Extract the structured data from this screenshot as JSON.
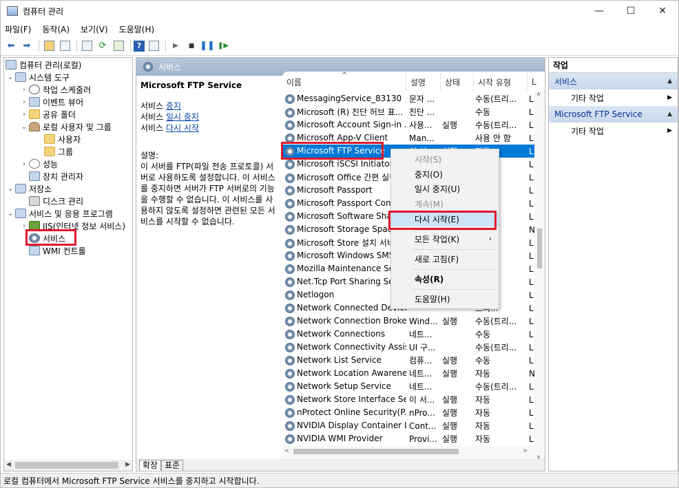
{
  "window": {
    "title": "컴퓨터 관리",
    "min": "—",
    "max": "☐",
    "close": "✕"
  },
  "menu": [
    "파일(F)",
    "동작(A)",
    "보기(V)",
    "도움말(H)"
  ],
  "tree": {
    "root": "컴퓨터 관리(로컬)",
    "system_tools": "시스템 도구",
    "task_scheduler": "작업 스케줄러",
    "event_viewer": "이벤트 뷰어",
    "shared_folders": "공유 폴더",
    "local_users": "로컬 사용자 및 그룹",
    "users": "사용자",
    "groups": "그룹",
    "performance": "성능",
    "device_manager": "장치 관리자",
    "storage": "저장소",
    "disk_mgmt": "디스크 관리",
    "services_apps": "서비스 및 응용 프로그램",
    "iis": "IIS(인터넷 정보 서비스)",
    "services": "서비스",
    "wmi": "WMI 컨트롤"
  },
  "center": {
    "header": "서비스",
    "service_name": "Microsoft FTP Service",
    "prefix": "서비스",
    "link_stop": "중지",
    "link_pause": "일시 중지",
    "link_restart": "다시 시작",
    "desc_label": "설명:",
    "desc_text": "이 서버를 FTP(파일 전송 프로토콜) 서버로 사용하도록 설정합니다. 이 서비스를 중지하면 서버가 FTP 서버로의 기능을 수행할 수 없습니다. 이 서비스를 사용하지 않도록 설정하면 관련된 모든 서비스를 시작할 수 없습니다."
  },
  "columns": {
    "name": "이름",
    "desc": "설명",
    "status": "상태",
    "startup": "시작 유형",
    "logon": "L"
  },
  "rows": [
    {
      "name": "MessagingService_83130",
      "desc": "문자 ...",
      "status": "",
      "startup": "수동(트리...",
      "logon": "L"
    },
    {
      "name": "Microsoft (R) 진단 허브 표...",
      "desc": "진단 ...",
      "status": "",
      "startup": "수동",
      "logon": "L"
    },
    {
      "name": "Microsoft Account Sign-in ...",
      "desc": "사용...",
      "status": "실행",
      "startup": "수동(트리...",
      "logon": "L"
    },
    {
      "name": "Microsoft App-V Client",
      "desc": "Man...",
      "status": "",
      "startup": "사용 안 함",
      "logon": "L"
    },
    {
      "name": "Microsoft FTP Service",
      "desc": "이 서...",
      "status": "실행",
      "startup": "자동",
      "logon": "L"
    },
    {
      "name": "Microsoft iSCSI Initiator S...",
      "desc": "",
      "status": "",
      "startup": "",
      "logon": "L"
    },
    {
      "name": "Microsoft Office 간편 실행...",
      "desc": "",
      "status": "",
      "startup": "",
      "logon": "L"
    },
    {
      "name": "Microsoft Passport",
      "desc": "",
      "status": "",
      "startup": "트리...",
      "logon": "L"
    },
    {
      "name": "Microsoft Passport Conta...",
      "desc": "",
      "status": "",
      "startup": "트리...",
      "logon": "L"
    },
    {
      "name": "Microsoft Software Shad...",
      "desc": "",
      "status": "",
      "startup": "",
      "logon": "L"
    },
    {
      "name": "Microsoft Storage Space...",
      "desc": "",
      "status": "",
      "startup": "",
      "logon": "N"
    },
    {
      "name": "Microsoft Store 설치 서비...",
      "desc": "",
      "status": "",
      "startup": "",
      "logon": "L"
    },
    {
      "name": "Microsoft Windows SMS ...",
      "desc": "",
      "status": "",
      "startup": "트리...",
      "logon": "L"
    },
    {
      "name": "Mozilla Maintenance Serv...",
      "desc": "",
      "status": "",
      "startup": "",
      "logon": "L"
    },
    {
      "name": "Net.Tcp Port Sharing Serv...",
      "desc": "",
      "status": "",
      "startup": "안 함",
      "logon": "L"
    },
    {
      "name": "Netlogon",
      "desc": "",
      "status": "",
      "startup": "",
      "logon": "L"
    },
    {
      "name": "Network Connected Device...",
      "desc": "",
      "status": "",
      "startup": "트리...",
      "logon": "L"
    },
    {
      "name": "Network Connection Broker",
      "desc": "Wind...",
      "status": "실행",
      "startup": "수동(트리...",
      "logon": "L"
    },
    {
      "name": "Network Connections",
      "desc": "네트...",
      "status": "",
      "startup": "수동",
      "logon": "L"
    },
    {
      "name": "Network Connectivity Assis...",
      "desc": "UI 구...",
      "status": "",
      "startup": "수동(트리...",
      "logon": "L"
    },
    {
      "name": "Network List Service",
      "desc": "컴퓨...",
      "status": "실행",
      "startup": "수동",
      "logon": "L"
    },
    {
      "name": "Network Location Awareness",
      "desc": "네트...",
      "status": "실행",
      "startup": "자동",
      "logon": "N"
    },
    {
      "name": "Network Setup Service",
      "desc": "네트...",
      "status": "",
      "startup": "수동(트리...",
      "logon": "L"
    },
    {
      "name": "Network Store Interface Se...",
      "desc": "이 서...",
      "status": "실행",
      "startup": "자동",
      "logon": "L"
    },
    {
      "name": "nProtect Online Security(P...",
      "desc": "nPro...",
      "status": "실행",
      "startup": "자동",
      "logon": "L"
    },
    {
      "name": "NVIDIA Display Container LS",
      "desc": "Cont...",
      "status": "실행",
      "startup": "자동",
      "logon": "L"
    },
    {
      "name": "NVIDIA WMI Provider",
      "desc": "Provi...",
      "status": "실행",
      "startup": "자동",
      "logon": "L"
    }
  ],
  "context_menu": {
    "start": "시작(S)",
    "stop": "중지(O)",
    "pause": "일시 중지(U)",
    "resume": "계속(M)",
    "restart": "다시 시작(E)",
    "all_tasks": "모든 작업(K)",
    "refresh": "새로 고침(F)",
    "properties": "속성(R)",
    "help": "도움말(H)"
  },
  "tabs": {
    "extended": "확장",
    "standard": "표준"
  },
  "actions": {
    "title": "작업",
    "section1": "서비스",
    "more1": "기타 작업",
    "section2": "Microsoft FTP Service",
    "more2": "기타 작업"
  },
  "status": "로컬 컴퓨터에서 Microsoft FTP Service 서비스를 중지하고 시작합니다.",
  "colors": {
    "selection": "#0078d7",
    "highlight": "#e0182d",
    "header": "#a9bdd4"
  }
}
